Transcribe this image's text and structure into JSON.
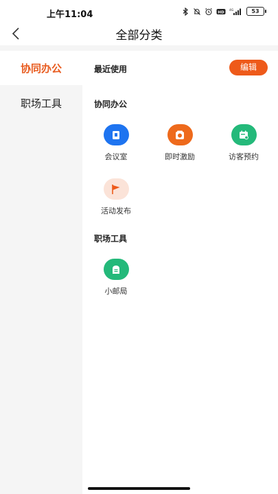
{
  "status": {
    "time": "上午11:04",
    "battery": "53"
  },
  "header": {
    "title": "全部分类"
  },
  "sidebar": {
    "items": [
      {
        "label": "协同办公"
      },
      {
        "label": "职场工具"
      }
    ]
  },
  "main": {
    "recent": {
      "title": "最近使用",
      "edit_label": "编辑"
    },
    "sections": [
      {
        "title": "协同办公",
        "items": [
          {
            "label": "会议室",
            "icon": "meeting-room-icon",
            "color": "#1e74f0"
          },
          {
            "label": "即时激励",
            "icon": "medal-icon",
            "color": "#ee6a1c"
          },
          {
            "label": "访客预约",
            "icon": "visitor-calendar-icon",
            "color": "#24b97a"
          },
          {
            "label": "活动发布",
            "icon": "flag-icon",
            "color": "#fbe3d8"
          }
        ]
      },
      {
        "title": "职场工具",
        "items": [
          {
            "label": "小邮局",
            "icon": "mailbox-icon",
            "color": "#24b97a"
          }
        ]
      }
    ]
  }
}
